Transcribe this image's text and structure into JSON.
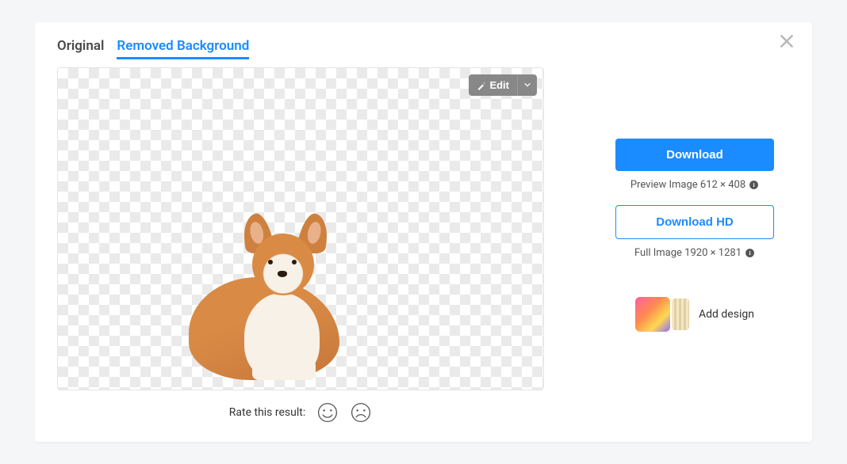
{
  "tabs": {
    "original": "Original",
    "removed": "Removed Background"
  },
  "edit": {
    "label": "Edit"
  },
  "rate": {
    "label": "Rate this result:"
  },
  "sidebar": {
    "download": "Download",
    "preview_caption": "Preview Image 612 × 408",
    "download_hd": "Download HD",
    "full_caption": "Full Image 1920 × 1281",
    "add_design": "Add design"
  }
}
